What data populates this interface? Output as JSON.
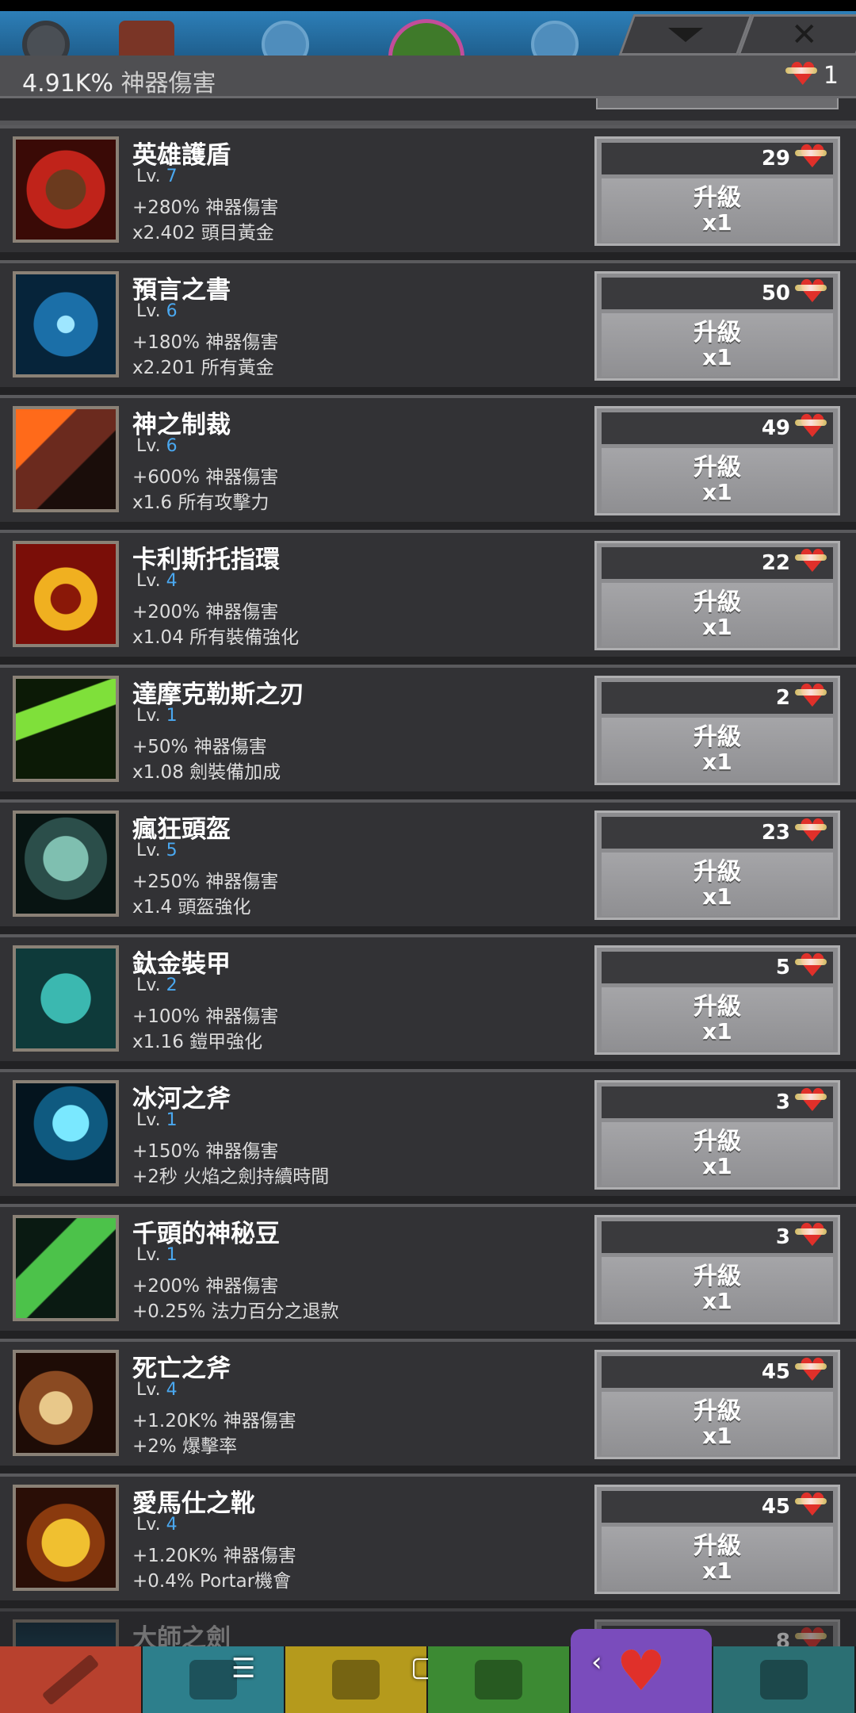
{
  "header": {
    "collapse_glyph": "chevron-down",
    "close_glyph": "✕"
  },
  "summary": {
    "damage_value": "4.91K%",
    "damage_label": "神器傷害",
    "relic_count": "1"
  },
  "upgrade_label": "升級",
  "multiplier_label": "x1",
  "level_prefix": "Lv.",
  "artifacts": [
    {
      "name": "英雄護盾",
      "level": "7",
      "bonus1": "+280% 神器傷害",
      "bonus2": "x2.402 頭目黃金",
      "cost": "29",
      "icon": "shield-icon"
    },
    {
      "name": "預言之書",
      "level": "6",
      "bonus1": "+180% 神器傷害",
      "bonus2": "x2.201 所有黃金",
      "cost": "50",
      "icon": "book-icon"
    },
    {
      "name": "神之制裁",
      "level": "6",
      "bonus1": "+600% 神器傷害",
      "bonus2": "x1.6 所有攻擊力",
      "cost": "49",
      "icon": "hammer-icon"
    },
    {
      "name": "卡利斯托指環",
      "level": "4",
      "bonus1": "+200% 神器傷害",
      "bonus2": "x1.04 所有裝備強化",
      "cost": "22",
      "icon": "ring-icon"
    },
    {
      "name": "達摩克勒斯之刃",
      "level": "1",
      "bonus1": "+50% 神器傷害",
      "bonus2": "x1.08 劍裝備加成",
      "cost": "2",
      "icon": "blade-icon"
    },
    {
      "name": "瘋狂頭盔",
      "level": "5",
      "bonus1": "+250% 神器傷害",
      "bonus2": "x1.4 頭盔強化",
      "cost": "23",
      "icon": "helmet-icon"
    },
    {
      "name": "鈦金裝甲",
      "level": "2",
      "bonus1": "+100% 神器傷害",
      "bonus2": "x1.16 鎧甲強化",
      "cost": "5",
      "icon": "armor-icon"
    },
    {
      "name": "冰河之斧",
      "level": "1",
      "bonus1": "+150% 神器傷害",
      "bonus2": "+2秒 火焰之劍持續時間",
      "cost": "3",
      "icon": "axe-icon"
    },
    {
      "name": "千頭的神秘豆",
      "level": "1",
      "bonus1": "+200% 神器傷害",
      "bonus2": "+0.25% 法力百分之退款",
      "cost": "3",
      "icon": "bean-icon"
    },
    {
      "name": "死亡之斧",
      "level": "4",
      "bonus1": "+1.20K% 神器傷害",
      "bonus2": "+2% 爆擊率",
      "cost": "45",
      "icon": "skull-axe-icon"
    },
    {
      "name": "愛馬仕之靴",
      "level": "4",
      "bonus1": "+1.20K% 神器傷害",
      "bonus2": "+0.4% Portar機會",
      "cost": "45",
      "icon": "boots-icon"
    }
  ],
  "partial_artifact": {
    "name": "大師之劍",
    "cost": "8",
    "icon": "sword-icon"
  },
  "colors": {
    "level_accent": "#4aa8f0",
    "heart_red": "#e0302a",
    "panel_bg": "#323235",
    "button_gray": "#8c8c8f"
  },
  "bottom_nav": [
    {
      "name": "sword-tab",
      "icon": "sword-icon"
    },
    {
      "name": "heroes-tab",
      "icon": "viking-icon"
    },
    {
      "name": "equipment-tab",
      "icon": "shirt-icon"
    },
    {
      "name": "pets-tab",
      "icon": "pet-icon"
    },
    {
      "name": "artifacts-tab",
      "icon": "heart-relic-icon"
    },
    {
      "name": "shop-tab",
      "icon": "chest-icon"
    }
  ],
  "system_nav": {
    "menu": "☰",
    "home": "▢",
    "back": "‹"
  }
}
